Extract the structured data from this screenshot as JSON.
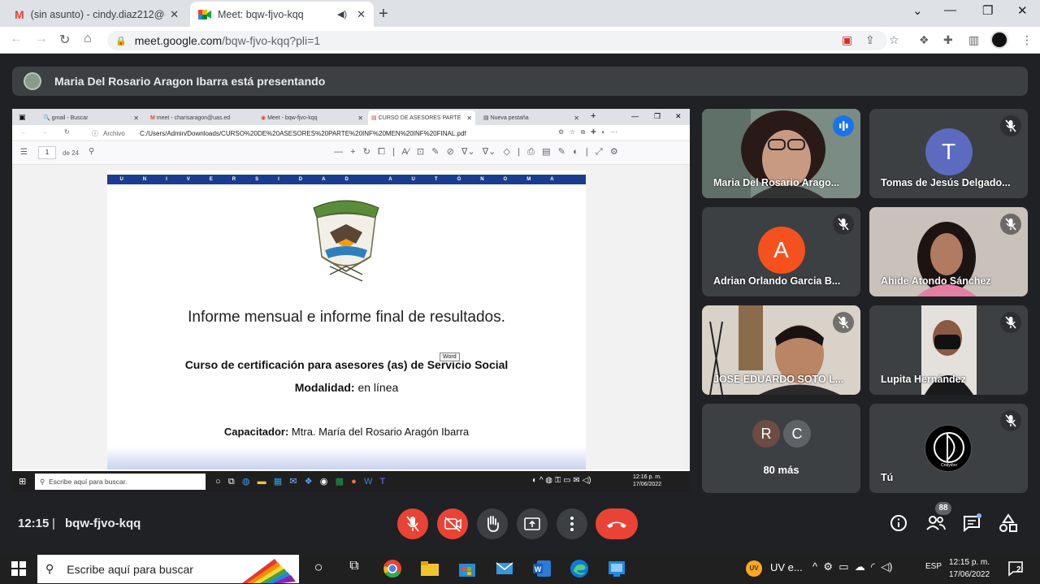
{
  "browser": {
    "tabs": [
      {
        "title": "(sin asunto) - cindy.diaz212@gm",
        "icon": "gmail-icon"
      },
      {
        "title": "Meet: bqw-fjvo-kqq",
        "icon": "meet-icon"
      }
    ],
    "url_host": "meet.google.com",
    "url_path": "/bqw-fjvo-kqq?pli=1"
  },
  "presenter_banner": "Maria Del Rosario Aragon Ibarra está presentando",
  "shared_screen": {
    "tabs": [
      "gmail - Buscar",
      "meet - charisaragon@uas.ed",
      "Meet - bqw-fjvo-kqq",
      "CURSO DE ASESORES PARTE",
      "Nueva pestaña"
    ],
    "addr_label": "Archivo",
    "addr_path": "C:/Users/Admin/Downloads/CURSO%20DE%20ASESORES%20PARTE%20INF%20MEN%20INF%20FINAL.pdf",
    "page_current": "1",
    "page_total": "de 24",
    "pdf": {
      "banner": "UNIVERSIDAD AUTÓNOMA DE SINALOA",
      "title": "Informe mensual e informe final de resultados.",
      "course": "Curso de certificación para asesores (as) de Servicio Social",
      "modality_label": "Modalidad:",
      "modality_value": " en línea",
      "trainer_label": "Capacitador:",
      "trainer_value": " Mtra. María del Rosario Aragón Ibarra"
    },
    "taskbar_search": "Escribe aquí para buscar.",
    "word_tooltip": "Word",
    "time": "12:16 p. m.",
    "date": "17/06/2022"
  },
  "participants": [
    {
      "name": "Maria Del Rosario Arago...",
      "type": "video",
      "speaking": true
    },
    {
      "name": "Tomas de Jesús Delgado...",
      "initial": "T",
      "color": "#5c6bc0",
      "muted": true
    },
    {
      "name": "Adrian Orlando Garcia B...",
      "initial": "A",
      "color": "#f4511e",
      "muted": true
    },
    {
      "name": "Ahide Atondo Sánchez",
      "type": "video",
      "muted": true
    },
    {
      "name": "JOSE EDUARDO SOTO L...",
      "type": "video",
      "muted": true
    },
    {
      "name": "Lupita Hernández",
      "type": "video",
      "muted": true
    },
    {
      "more_initials": [
        "R",
        "C"
      ],
      "more_label": "80 más"
    },
    {
      "name": "Tú",
      "type": "logo",
      "muted": true,
      "logo_text": "Cndydvo"
    }
  ],
  "meeting": {
    "time": "12:15",
    "separator": "|",
    "code": "bqw-fjvo-kqq",
    "participant_count": "88"
  },
  "windows": {
    "search_placeholder": "Escribe aquí para buscar",
    "tray_app": "UV e...",
    "lang": "ESP",
    "time": "12:15 p. m.",
    "date": "17/06/2022",
    "notifications": "2"
  },
  "colors": {
    "meet_bg": "#202124",
    "tile_bg": "#3c4043",
    "red": "#ea4335",
    "speaking": "#8ab4f8"
  }
}
